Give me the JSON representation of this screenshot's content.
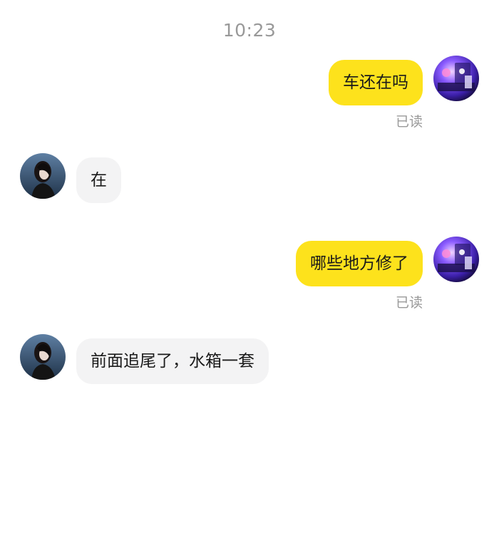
{
  "timestamp": "10:23",
  "messages": [
    {
      "sender": "me",
      "text": "车还在吗",
      "status": "已读"
    },
    {
      "sender": "other",
      "text": "在"
    },
    {
      "sender": "me",
      "text": "哪些地方修了",
      "status": "已读"
    },
    {
      "sender": "other",
      "text": "前面追尾了，水箱一套"
    }
  ],
  "colors": {
    "my_bubble": "#fde21c",
    "other_bubble": "#f3f3f4",
    "meta_text": "#999999"
  },
  "icons": {
    "my_avatar": "pc-rgb-setup-avatar",
    "other_avatar": "woman-portrait-avatar"
  }
}
